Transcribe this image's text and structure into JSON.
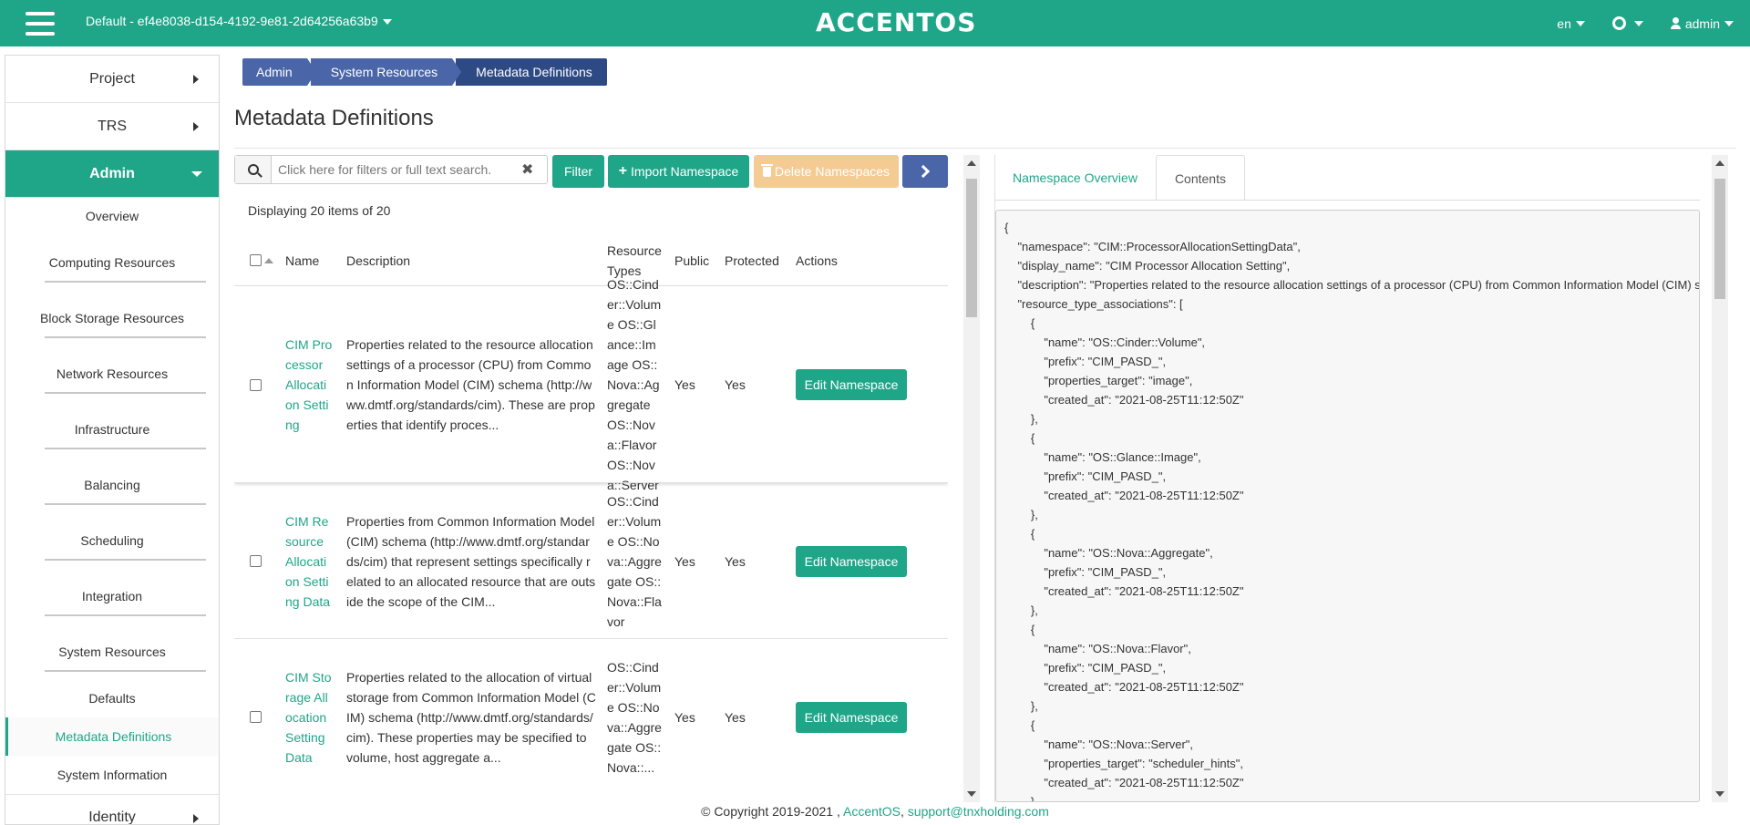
{
  "header": {
    "project": "Default - ef4e8038-d154-4192-9e81-2d64256a63b9",
    "logo": "ACCENTOS",
    "language": "en",
    "user": "admin",
    "accent_color": "#1fa689"
  },
  "sidebar": {
    "sections": [
      {
        "label": "Project"
      },
      {
        "label": "TRS"
      },
      {
        "label": "Admin"
      }
    ],
    "admin_items": [
      {
        "label": "Overview"
      },
      {
        "label": "Computing Resources"
      },
      {
        "label": "Block Storage Resources"
      },
      {
        "label": "Network Resources"
      },
      {
        "label": "Infrastructure"
      },
      {
        "label": "Balancing"
      },
      {
        "label": "Scheduling"
      },
      {
        "label": "Integration"
      },
      {
        "label": "System Resources"
      },
      {
        "label": "Defaults"
      },
      {
        "label": "Metadata Definitions"
      },
      {
        "label": "System Information"
      }
    ],
    "identity": "Identity"
  },
  "breadcrumb": [
    "Admin",
    "System Resources",
    "Metadata Definitions"
  ],
  "page_title": "Metadata Definitions",
  "toolbar": {
    "search_placeholder": "Click here for filters or full text search.",
    "filter_label": "Filter",
    "import_label": "Import Namespace",
    "delete_label": "Delete Namespaces"
  },
  "displaying": "Displaying 20 items of 20",
  "table": {
    "columns": {
      "name": "Name",
      "description": "Description",
      "resource_types": "Resource Types",
      "public": "Public",
      "protected": "Protected",
      "actions": "Actions"
    },
    "rows": [
      {
        "name": "CIM Processor Allocation Setting",
        "description": "Properties related to the resource allocation settings of a processor (CPU) from Common Information Model (CIM) schema (http://www.dmtf.org/standards/cim). These are properties that identify proces...",
        "resource_types": [
          "OS::Cinder::Volume",
          "OS::Glance::Image",
          "OS::Nova::Aggregate",
          "OS::Nova::Flavor",
          "OS::Nova::Server"
        ],
        "public": "Yes",
        "protected": "Yes",
        "action": "Edit Namespace"
      },
      {
        "name": "CIM Resource Allocation Setting Data",
        "description": "Properties from Common Information Model (CIM) schema (http://www.dmtf.org/standards/cim) that represent settings specifically related to an allocated resource that are outside the scope of the CIM...",
        "resource_types": [
          "OS::Cinder::Volume",
          "OS::Nova::Aggregate",
          "OS::Nova::Flavor"
        ],
        "public": "Yes",
        "protected": "Yes",
        "action": "Edit Namespace"
      },
      {
        "name": "CIM Storage Allocation Setting Data",
        "description": "Properties related to the allocation of virtual storage from Common Information Model (CIM) schema (http://www.dmtf.org/standards/cim). These properties may be specified to volume, host aggregate a...",
        "resource_types": [
          "OS::Cinder::Volume",
          "OS::Nova::Aggregate",
          "OS::Nova::..."
        ],
        "public": "Yes",
        "protected": "Yes",
        "action": "Edit Namespace"
      }
    ]
  },
  "right_tabs": [
    "Namespace Overview",
    "Contents"
  ],
  "contents_lines": [
    "{",
    "    \"namespace\": \"CIM::ProcessorAllocationSettingData\",",
    "    \"display_name\": \"CIM Processor Allocation Setting\",",
    "    \"description\": \"Properties related to the resource allocation settings of a processor (CPU) from Common Information Model (CIM) schema",
    "    \"resource_type_associations\": [",
    "        {",
    "            \"name\": \"OS::Cinder::Volume\",",
    "            \"prefix\": \"CIM_PASD_\",",
    "            \"properties_target\": \"image\",",
    "            \"created_at\": \"2021-08-25T11:12:50Z\"",
    "        },",
    "        {",
    "            \"name\": \"OS::Glance::Image\",",
    "            \"prefix\": \"CIM_PASD_\",",
    "            \"created_at\": \"2021-08-25T11:12:50Z\"",
    "        },",
    "        {",
    "            \"name\": \"OS::Nova::Aggregate\",",
    "            \"prefix\": \"CIM_PASD_\",",
    "            \"created_at\": \"2021-08-25T11:12:50Z\"",
    "        },",
    "        {",
    "            \"name\": \"OS::Nova::Flavor\",",
    "            \"prefix\": \"CIM_PASD_\",",
    "            \"created_at\": \"2021-08-25T11:12:50Z\"",
    "        },",
    "        {",
    "            \"name\": \"OS::Nova::Server\",",
    "            \"properties_target\": \"scheduler_hints\",",
    "            \"created_at\": \"2021-08-25T11:12:50Z\"",
    "        },"
  ],
  "footer": {
    "copyright": "© Copyright 2019-2021 ,",
    "brand": "AccentOS",
    "email": "support@tnxholding.com"
  }
}
